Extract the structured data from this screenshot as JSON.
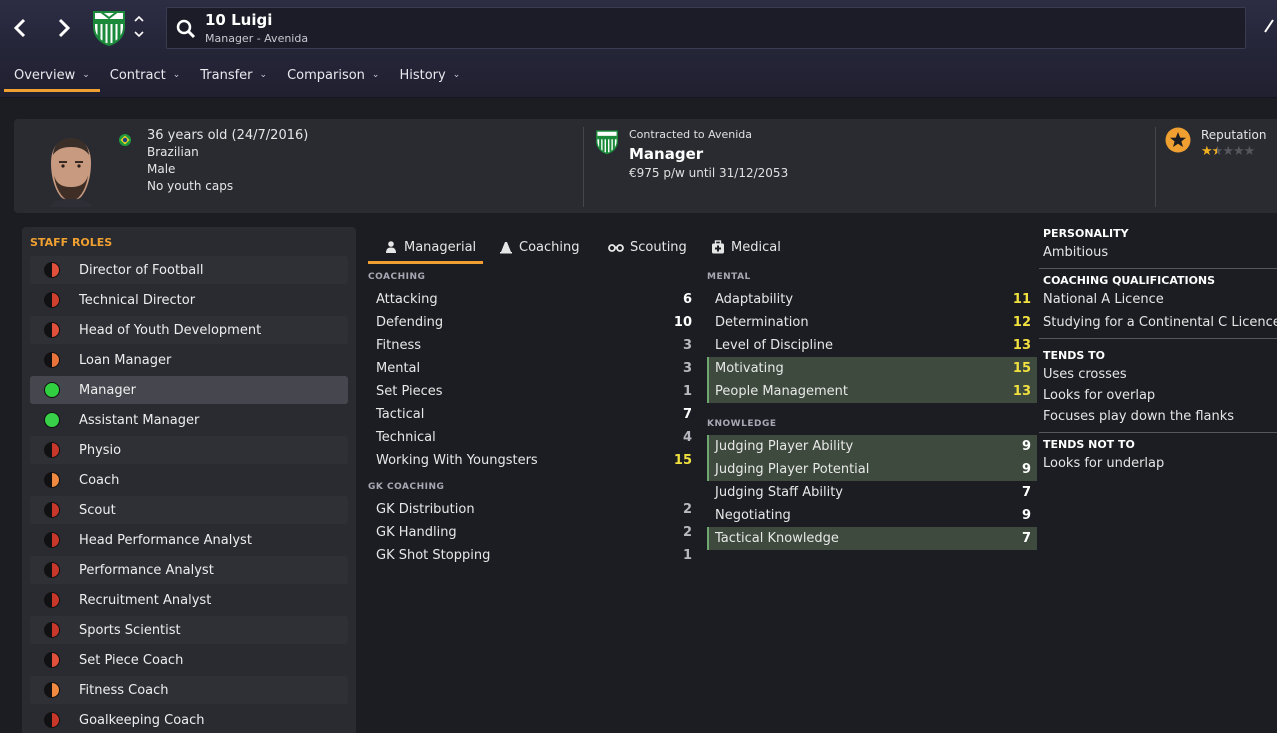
{
  "header": {
    "title": "10 Luigi",
    "subtitle": "Manager - Avenida"
  },
  "tabs": [
    {
      "label": "Overview",
      "active": true
    },
    {
      "label": "Contract",
      "active": false
    },
    {
      "label": "Transfer",
      "active": false
    },
    {
      "label": "Comparison",
      "active": false
    },
    {
      "label": "History",
      "active": false
    }
  ],
  "profile": {
    "age_line": "36 years old (24/7/2016)",
    "nationality": "Brazilian",
    "gender": "Male",
    "youth_caps": "No youth caps",
    "contract_line": "Contracted to Avenida",
    "role": "Manager",
    "wage": "€975 p/w until 31/12/2053",
    "reputation_label": "Reputation",
    "reputation_stars": 1.5,
    "reputation_max": 5
  },
  "staff_roles": {
    "title": "STAFF ROLES",
    "items": [
      {
        "label": "Director of Football",
        "color": "#e0503a",
        "half": true
      },
      {
        "label": "Technical Director",
        "color": "#d0402e",
        "half": true
      },
      {
        "label": "Head of Youth Development",
        "color": "#e0503a",
        "half": true
      },
      {
        "label": "Loan Manager",
        "color": "#e8743a",
        "half": true
      },
      {
        "label": "Manager",
        "color": "#30d040",
        "half": false,
        "selected": true
      },
      {
        "label": "Assistant Manager",
        "color": "#38d048",
        "half": false
      },
      {
        "label": "Physio",
        "color": "#c8382a",
        "half": true
      },
      {
        "label": "Coach",
        "color": "#f08a40",
        "half": true
      },
      {
        "label": "Scout",
        "color": "#c8382a",
        "half": true
      },
      {
        "label": "Head Performance Analyst",
        "color": "#c8382a",
        "half": true
      },
      {
        "label": "Performance Analyst",
        "color": "#c8382a",
        "half": true
      },
      {
        "label": "Recruitment Analyst",
        "color": "#c8382a",
        "half": true
      },
      {
        "label": "Sports Scientist",
        "color": "#c8382a",
        "half": true
      },
      {
        "label": "Set Piece Coach",
        "color": "#e0503a",
        "half": true
      },
      {
        "label": "Fitness Coach",
        "color": "#f08a40",
        "half": true
      },
      {
        "label": "Goalkeeping Coach",
        "color": "#c8382a",
        "half": true
      }
    ]
  },
  "attr_tabs": [
    {
      "label": "Managerial",
      "icon": "managerial-icon",
      "active": true
    },
    {
      "label": "Coaching",
      "icon": "coaching-icon",
      "active": false
    },
    {
      "label": "Scouting",
      "icon": "binoculars-icon",
      "active": false
    },
    {
      "label": "Medical",
      "icon": "medical-icon",
      "active": false
    }
  ],
  "coaching": {
    "title": "COACHING",
    "rows": [
      {
        "name": "Attacking",
        "value": "6"
      },
      {
        "name": "Defending",
        "value": "10"
      },
      {
        "name": "Fitness",
        "value": "3"
      },
      {
        "name": "Mental",
        "value": "3"
      },
      {
        "name": "Set Pieces",
        "value": "1"
      },
      {
        "name": "Tactical",
        "value": "7"
      },
      {
        "name": "Technical",
        "value": "4"
      },
      {
        "name": "Working With Youngsters",
        "value": "15"
      }
    ]
  },
  "gk_coaching": {
    "title": "GK COACHING",
    "rows": [
      {
        "name": "GK Distribution",
        "value": "2"
      },
      {
        "name": "GK Handling",
        "value": "2"
      },
      {
        "name": "GK Shot Stopping",
        "value": "1"
      }
    ]
  },
  "mental": {
    "title": "MENTAL",
    "rows": [
      {
        "name": "Adaptability",
        "value": "11",
        "hl": false
      },
      {
        "name": "Determination",
        "value": "12",
        "hl": false
      },
      {
        "name": "Level of Discipline",
        "value": "13",
        "hl": false
      },
      {
        "name": "Motivating",
        "value": "15",
        "hl": true
      },
      {
        "name": "People Management",
        "value": "13",
        "hl": true
      }
    ]
  },
  "knowledge": {
    "title": "KNOWLEDGE",
    "rows": [
      {
        "name": "Judging Player Ability",
        "value": "9",
        "hl": true
      },
      {
        "name": "Judging Player Potential",
        "value": "9",
        "hl": true
      },
      {
        "name": "Judging Staff Ability",
        "value": "7",
        "hl": false
      },
      {
        "name": "Negotiating",
        "value": "9",
        "hl": false
      },
      {
        "name": "Tactical Knowledge",
        "value": "7",
        "hl": true
      }
    ]
  },
  "info": {
    "personality_title": "PERSONALITY",
    "personality": "Ambitious",
    "quals_title": "COACHING QUALIFICATIONS",
    "quals": [
      "National A Licence",
      "Studying for a Continental C Licence"
    ],
    "tends_title": "TENDS TO",
    "tends": [
      "Uses crosses",
      "Looks for overlap",
      "Focuses play down the flanks"
    ],
    "tends_not_title": "TENDS NOT TO",
    "tends_not": [
      "Looks for underlap"
    ]
  },
  "colors": {
    "accent": "#f0a030",
    "value_low": "#b8b8c0",
    "value_mid": "#ffffff",
    "value_high": "#f0e040",
    "highlight_row": "#3d4a3d"
  }
}
